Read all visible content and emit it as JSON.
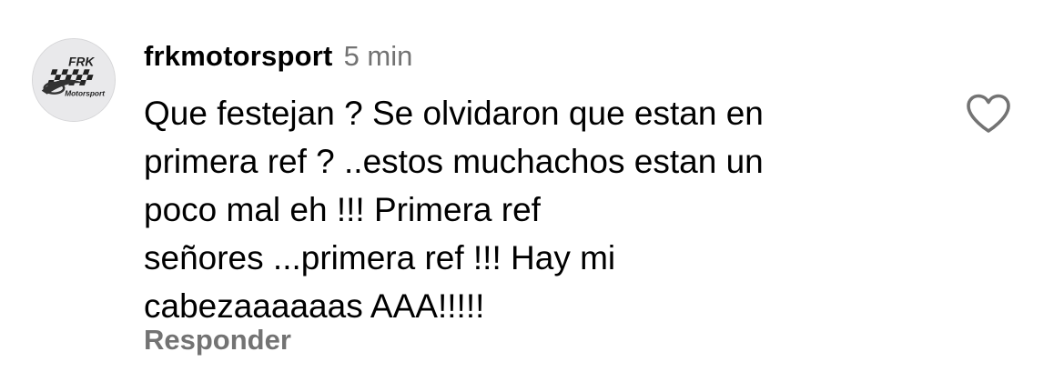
{
  "comment": {
    "avatar": {
      "icon": "frk-motorsport-logo",
      "logo_text_top": "FRK",
      "logo_text_bottom": "Motorsport"
    },
    "username": "frkmotorsport",
    "timestamp": "5 min",
    "text_lines": [
      "Que festejan ? Se olvidaron que estan en",
      "primera ref ? ..estos muchachos estan un",
      "poco mal eh !!! Primera ref",
      "señores ...primera ref !!! Hay mi",
      "cabezaaaaaas AAA!!!!!"
    ],
    "reply_label": "Responder",
    "like_icon": "heart-outline-icon"
  },
  "colors": {
    "text_primary": "#000000",
    "text_secondary": "#737373",
    "avatar_bg": "#e9e9eb",
    "like_stroke": "#737373"
  }
}
